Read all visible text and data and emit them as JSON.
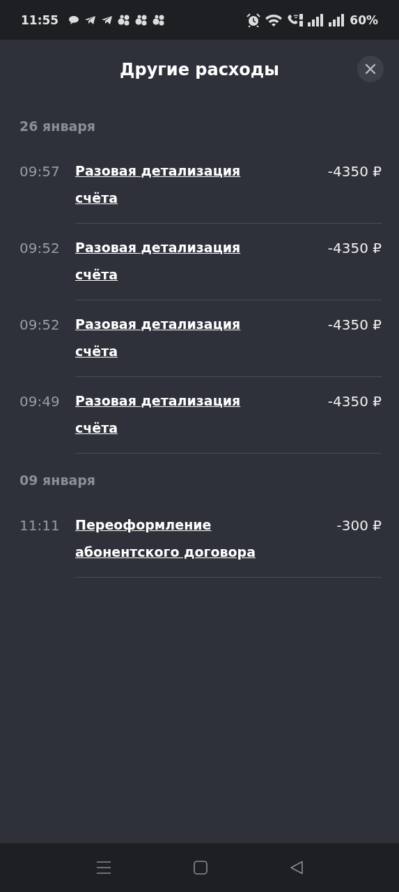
{
  "status_bar": {
    "time": "11:55",
    "battery": "60%"
  },
  "sheet": {
    "title": "Другие расходы"
  },
  "groups": [
    {
      "date": "26 января",
      "items": [
        {
          "time": "09:57",
          "title": "Разовая детализация счёта",
          "amount": "-4350 ₽"
        },
        {
          "time": "09:52",
          "title": "Разовая детализация счёта",
          "amount": "-4350 ₽"
        },
        {
          "time": "09:52",
          "title": "Разовая детализация счёта",
          "amount": "-4350 ₽"
        },
        {
          "time": "09:49",
          "title": "Разовая детализация счёта",
          "amount": "-4350 ₽"
        }
      ]
    },
    {
      "date": "09 января",
      "items": [
        {
          "time": "11:11",
          "title": "Переоформление абонентского договора",
          "amount": "-300 ₽"
        }
      ]
    }
  ]
}
